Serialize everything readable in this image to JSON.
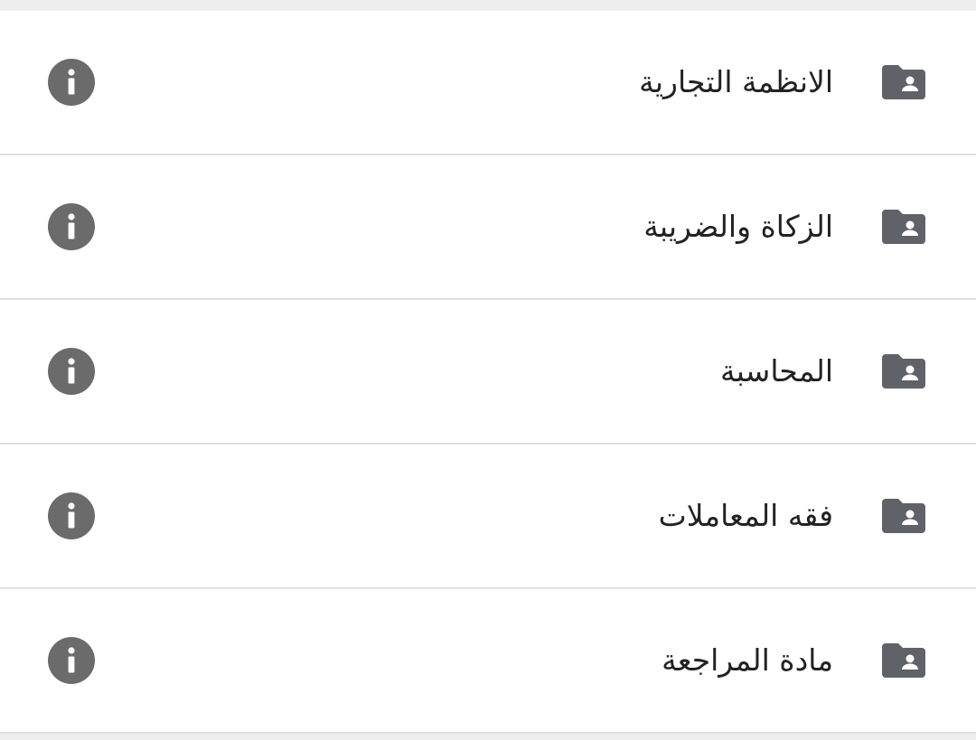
{
  "colors": {
    "icon": "#5f6368",
    "info": "#6b6b6b",
    "text": "#222222",
    "divider": "#e0e0e0",
    "background": "#ffffff"
  },
  "list": {
    "items": [
      {
        "label": "الانظمة التجارية",
        "icon": "folder-shared-icon",
        "action_icon": "info-icon"
      },
      {
        "label": "الزكاة والضريبة",
        "icon": "folder-shared-icon",
        "action_icon": "info-icon"
      },
      {
        "label": "المحاسبة",
        "icon": "folder-shared-icon",
        "action_icon": "info-icon"
      },
      {
        "label": "فقه المعاملات",
        "icon": "folder-shared-icon",
        "action_icon": "info-icon"
      },
      {
        "label": "مادة المراجعة",
        "icon": "folder-shared-icon",
        "action_icon": "info-icon"
      }
    ]
  }
}
